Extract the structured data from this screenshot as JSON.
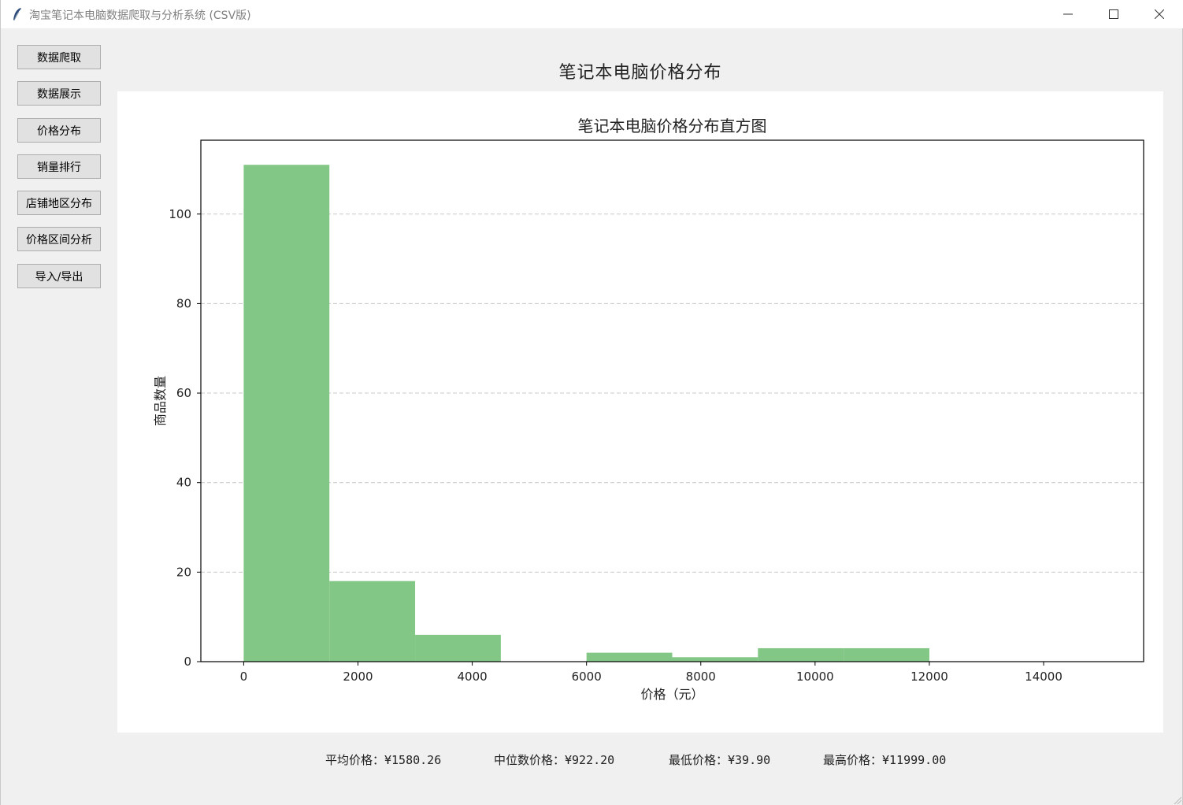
{
  "window": {
    "title": "淘宝笔记本电脑数据爬取与分析系统 (CSV版)",
    "icon": "feather-icon",
    "controls": {
      "minimize": "—",
      "maximize": "☐",
      "close": "✕"
    }
  },
  "sidebar": {
    "buttons": [
      {
        "label": "数据爬取"
      },
      {
        "label": "数据展示"
      },
      {
        "label": "价格分布"
      },
      {
        "label": "销量排行"
      },
      {
        "label": "店铺地区分布"
      },
      {
        "label": "价格区间分析"
      },
      {
        "label": "导入/导出"
      }
    ]
  },
  "main": {
    "page_title": "笔记本电脑价格分布"
  },
  "chart_data": {
    "type": "bar",
    "title": "笔记本电脑价格分布直方图",
    "xlabel": "价格（元）",
    "ylabel": "商品数量",
    "bin_width": 1500,
    "bin_starts": [
      0,
      1500,
      3000,
      4500,
      6000,
      7500,
      9000,
      10500
    ],
    "values": [
      111,
      18,
      6,
      0,
      2,
      1,
      3,
      3
    ],
    "xlim": [
      -750,
      15750
    ],
    "ylim": [
      0,
      116.5
    ],
    "xticks": [
      0,
      2000,
      4000,
      6000,
      8000,
      10000,
      12000,
      14000
    ],
    "yticks": [
      0,
      20,
      40,
      60,
      80,
      100
    ],
    "bar_color": "#82c785",
    "grid": "y-dashed"
  },
  "stats": {
    "mean": "平均价格：¥1580.26",
    "median": "中位数价格：¥922.20",
    "min": "最低价格：¥39.90",
    "max": "最高价格：¥11999.00"
  }
}
